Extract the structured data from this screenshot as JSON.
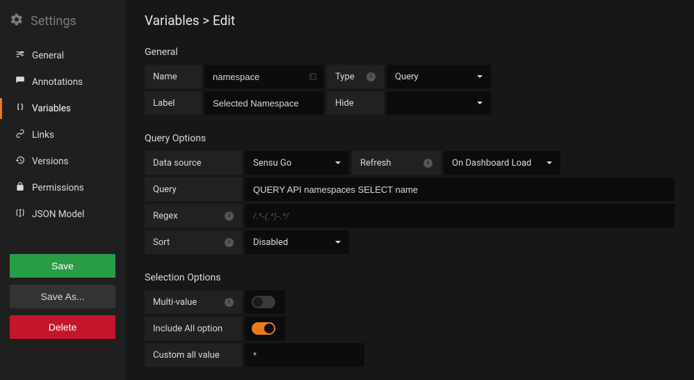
{
  "sidebar": {
    "title": "Settings",
    "items": [
      {
        "label": "General"
      },
      {
        "label": "Annotations"
      },
      {
        "label": "Variables"
      },
      {
        "label": "Links"
      },
      {
        "label": "Versions"
      },
      {
        "label": "Permissions"
      },
      {
        "label": "JSON Model"
      }
    ],
    "actions": {
      "save": "Save",
      "save_as": "Save As...",
      "delete": "Delete"
    }
  },
  "breadcrumb": "Variables > Edit",
  "sections": {
    "general": {
      "title": "General",
      "name_label": "Name",
      "name_value": "namespace",
      "type_label": "Type",
      "type_value": "Query",
      "label_label": "Label",
      "label_value": "Selected Namespace",
      "hide_label": "Hide",
      "hide_value": ""
    },
    "query": {
      "title": "Query Options",
      "datasource_label": "Data source",
      "datasource_value": "Sensu Go",
      "refresh_label": "Refresh",
      "refresh_value": "On Dashboard Load",
      "query_label": "Query",
      "query_value": "QUERY API namespaces SELECT name",
      "regex_label": "Regex",
      "regex_placeholder": "/.*-(.*)-.*/",
      "regex_value": "",
      "sort_label": "Sort",
      "sort_value": "Disabled"
    },
    "selection": {
      "title": "Selection Options",
      "multi_label": "Multi-value",
      "include_all_label": "Include All option",
      "custom_all_label": "Custom all value",
      "custom_all_value": "*"
    }
  }
}
